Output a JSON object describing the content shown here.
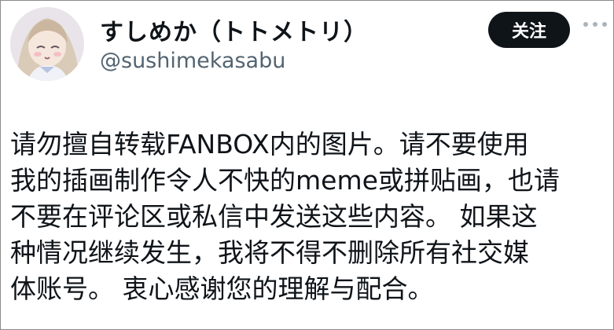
{
  "profile": {
    "display_name": "すしめか（トトメトリ）",
    "handle": "@sushimekasabu"
  },
  "actions": {
    "follow_label": "关注",
    "more_icon": "more-horizontal-icon"
  },
  "post": {
    "lines": [
      "请勿擅自转载FANBOX内的图片。请不要使用",
      "我的插画制作令人不快的meme或拼贴画，也请",
      "不要在评论区或私信中发送这些内容。 如果这",
      "种情况继续发生，我将不得不删除所有社交媒",
      "体账号。 衷心感谢您的理解与配合。"
    ]
  },
  "colors": {
    "text": "#0f1419",
    "handle": "#536471",
    "button_bg": "#0f1419",
    "button_text": "#ffffff"
  }
}
